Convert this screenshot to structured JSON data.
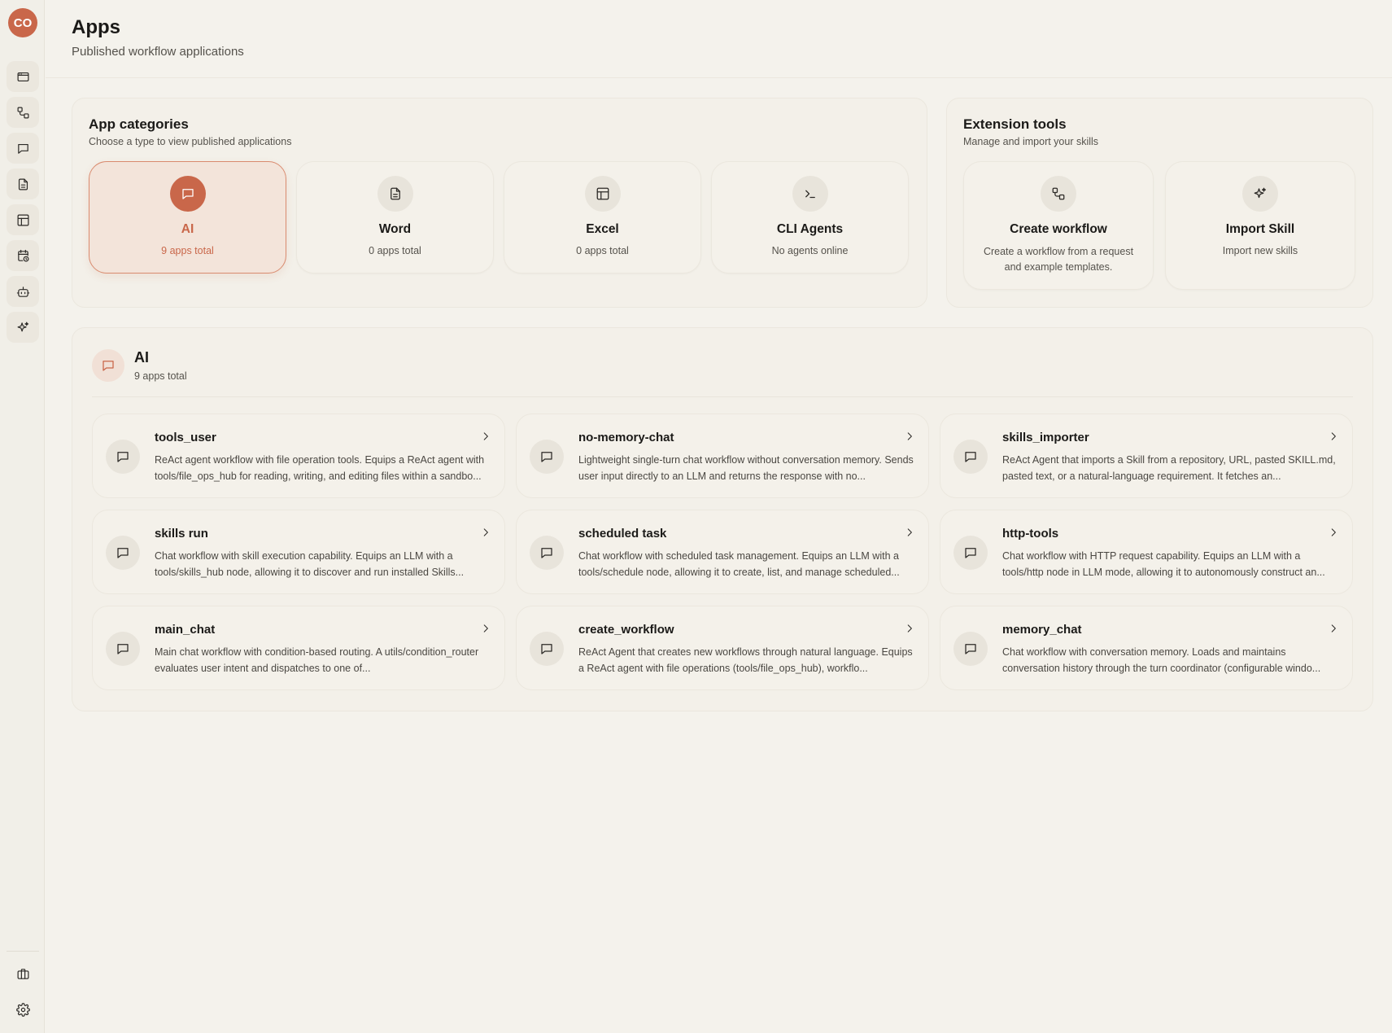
{
  "user": {
    "initials": "CO"
  },
  "header": {
    "title": "Apps",
    "subtitle": "Published workflow applications"
  },
  "categories_panel": {
    "title": "App categories",
    "subtitle": "Choose a type to view published applications",
    "items": [
      {
        "name": "AI",
        "count": "9 apps total",
        "icon": "message-icon",
        "active": true
      },
      {
        "name": "Word",
        "count": "0 apps total",
        "icon": "document-icon"
      },
      {
        "name": "Excel",
        "count": "0 apps total",
        "icon": "table-icon"
      },
      {
        "name": "CLI Agents",
        "count": "No agents online",
        "icon": "terminal-icon"
      }
    ]
  },
  "extensions_panel": {
    "title": "Extension tools",
    "subtitle": "Manage and import your skills",
    "items": [
      {
        "name": "Create workflow",
        "description": "Create a workflow from a request and example templates.",
        "icon": "workflow-icon"
      },
      {
        "name": "Import Skill",
        "description": "Import new skills",
        "icon": "sparkle-icon"
      }
    ]
  },
  "apps_section": {
    "title": "AI",
    "count": "9 apps total",
    "apps": [
      {
        "name": "tools_user",
        "description": "ReAct agent workflow with file operation tools. Equips a ReAct agent with tools/file_ops_hub for reading, writing, and editing files within a sandbo..."
      },
      {
        "name": "no-memory-chat",
        "description": "Lightweight single-turn chat workflow without conversation memory. Sends user input directly to an LLM and returns the response with no..."
      },
      {
        "name": "skills_importer",
        "description": "ReAct Agent that imports a Skill from a repository, URL, pasted SKILL.md, pasted text, or a natural-language requirement. It fetches an..."
      },
      {
        "name": "skills run",
        "description": "Chat workflow with skill execution capability. Equips an LLM with a tools/skills_hub node, allowing it to discover and run installed Skills..."
      },
      {
        "name": "scheduled task",
        "description": "Chat workflow with scheduled task management. Equips an LLM with a tools/schedule node, allowing it to create, list, and manage scheduled..."
      },
      {
        "name": "http-tools",
        "description": "Chat workflow with HTTP request capability. Equips an LLM with a tools/http node in LLM mode, allowing it to autonomously construct an..."
      },
      {
        "name": "main_chat",
        "description": "Main chat workflow with condition-based routing. A utils/condition_router evaluates user intent and dispatches to one of..."
      },
      {
        "name": "create_workflow",
        "description": "ReAct Agent that creates new workflows through natural language. Equips a ReAct agent with file operations (tools/file_ops_hub), workflo..."
      },
      {
        "name": "memory_chat",
        "description": "Chat workflow with conversation memory. Loads and maintains conversation history through the turn coordinator (configurable windo..."
      }
    ]
  },
  "colors": {
    "accent": "#c9674a",
    "background": "#f4f2ec",
    "active_card": "#f3e4da"
  }
}
